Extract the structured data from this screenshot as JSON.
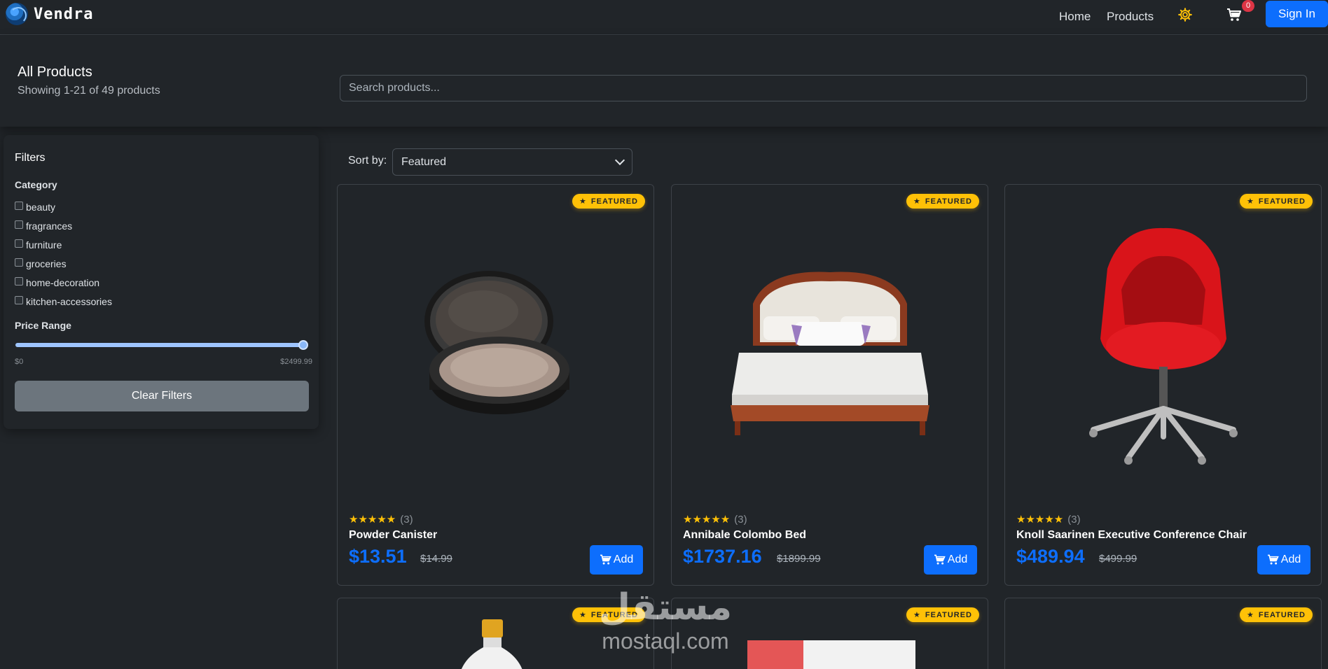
{
  "navbar": {
    "brand": "Vendra",
    "links": [
      "Home",
      "Products"
    ],
    "cart_count": "0",
    "signin_label": "Sign In",
    "gear_icon_color": "#ffc107"
  },
  "header": {
    "title": "All Products",
    "subtitle": "Showing 1-21 of 49 products",
    "search_placeholder": "Search products..."
  },
  "filters": {
    "title": "Filters",
    "category_title": "Category",
    "categories": [
      "beauty",
      "fragrances",
      "furniture",
      "groceries",
      "home-decoration",
      "kitchen-accessories"
    ],
    "price_title": "Price Range",
    "price_min": "$0",
    "price_max": "$2499.99",
    "slider_value_fraction": 1.0,
    "clear_label": "Clear Filters"
  },
  "sort": {
    "label": "Sort by:",
    "selected": "Featured"
  },
  "products": [
    {
      "badge": "FEATURED",
      "rating": 5,
      "reviews": "(3)",
      "name": "Powder Canister",
      "price": "$13.51",
      "old_price": "$14.99",
      "add_label": "Add",
      "image": "powder-canister-image"
    },
    {
      "badge": "FEATURED",
      "rating": 5,
      "reviews": "(3)",
      "name": "Annibale Colombo Bed",
      "price": "$1737.16",
      "old_price": "$1899.99",
      "add_label": "Add",
      "image": "bed-image"
    },
    {
      "badge": "FEATURED",
      "rating": 5,
      "reviews": "(3)",
      "name": "Knoll Saarinen Executive Conference Chair",
      "price": "$489.94",
      "old_price": "$499.99",
      "add_label": "Add",
      "image": "chair-image"
    },
    {
      "badge": "FEATURED",
      "image": "bottle-image"
    },
    {
      "badge": "FEATURED",
      "image": "package-image"
    },
    {
      "badge": "FEATURED",
      "image": "empty-image"
    }
  ],
  "watermark": {
    "arabic": "مستقل",
    "latin": "mostaql.com"
  },
  "colors": {
    "background": "#212529",
    "primary": "#0d6efd",
    "badge": "#ffc107",
    "danger": "#dc3545",
    "secondary": "#6c757d"
  }
}
